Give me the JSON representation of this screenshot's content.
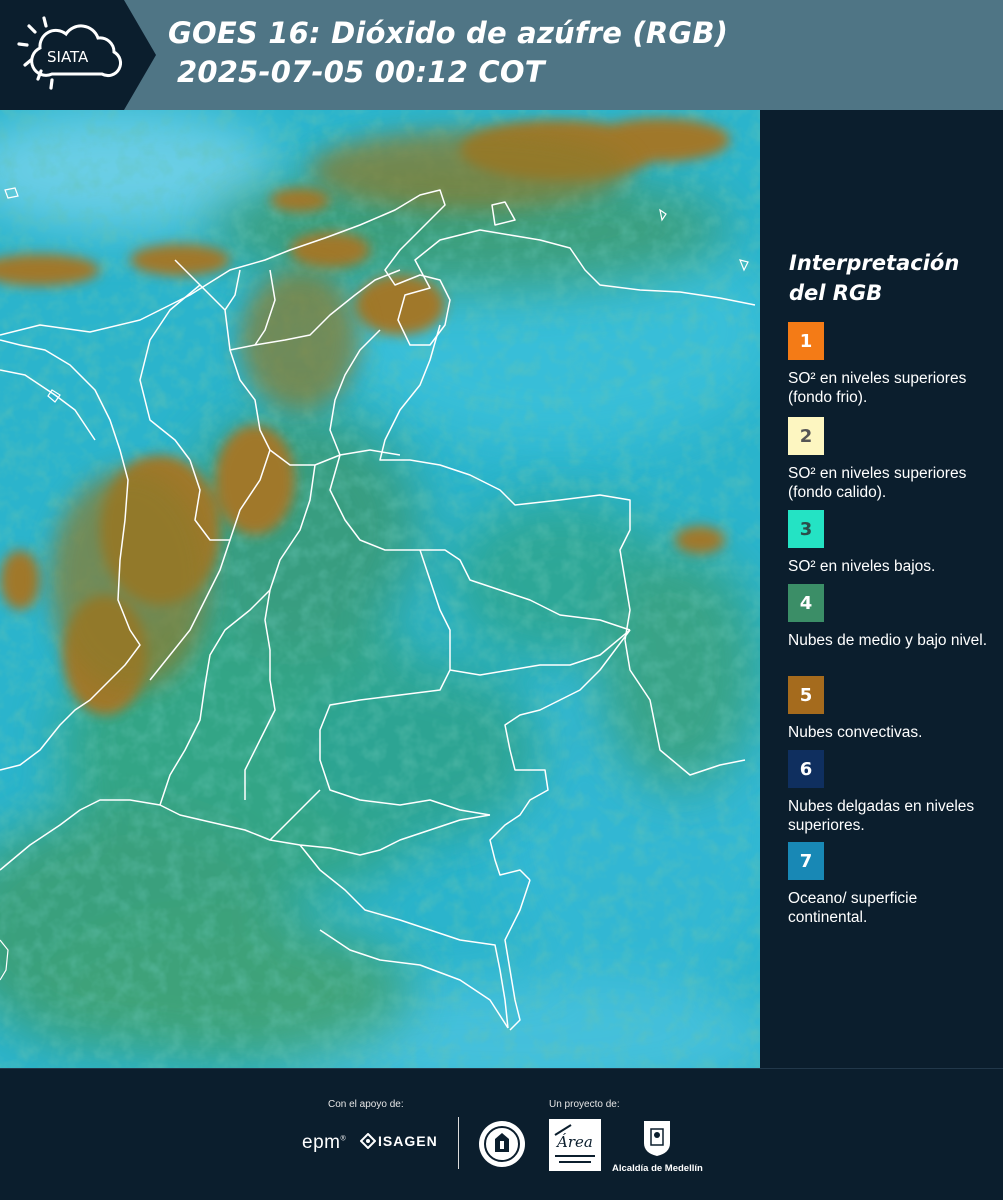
{
  "header": {
    "logo_text": "SIATA",
    "title_line1": "GOES 16: Dióxido de azúfre (RGB)",
    "title_line2": "2025-07-05 00:12 COT"
  },
  "legend": {
    "title": "Interpretación del RGB",
    "items": [
      {
        "number": "1",
        "color": "#f47b16",
        "num_color": "#ffffff",
        "text": "SO² en niveles superiores (fondo frio)."
      },
      {
        "number": "2",
        "color": "#fdf6c1",
        "num_color": "#555555",
        "text": "SO² en niveles superiores (fondo calido)."
      },
      {
        "number": "3",
        "color": "#24e3c4",
        "num_color": "#2b4d4a",
        "text": "SO² en niveles bajos."
      },
      {
        "number": "4",
        "color": "#3b8e67",
        "num_color": "#ffffff",
        "text": "Nubes de medio y bajo nivel."
      },
      {
        "number": "5",
        "color": "#a56b1d",
        "num_color": "#ffffff",
        "text": "Nubes convectivas."
      },
      {
        "number": "6",
        "color": "#0f2f5f",
        "num_color": "#ffffff",
        "text": "Nubes delgadas en niveles superiores."
      },
      {
        "number": "7",
        "color": "#1888b5",
        "num_color": "#ffffff",
        "text": "Oceano/ superficie continental."
      }
    ]
  },
  "footer": {
    "support_label": "Con el apoyo de:",
    "project_label": "Un proyecto de:",
    "epm": "epm",
    "isagen": "ISAGEN",
    "area_logo_text": "Área",
    "alcaldia": "Alcaldía de Medellín"
  }
}
